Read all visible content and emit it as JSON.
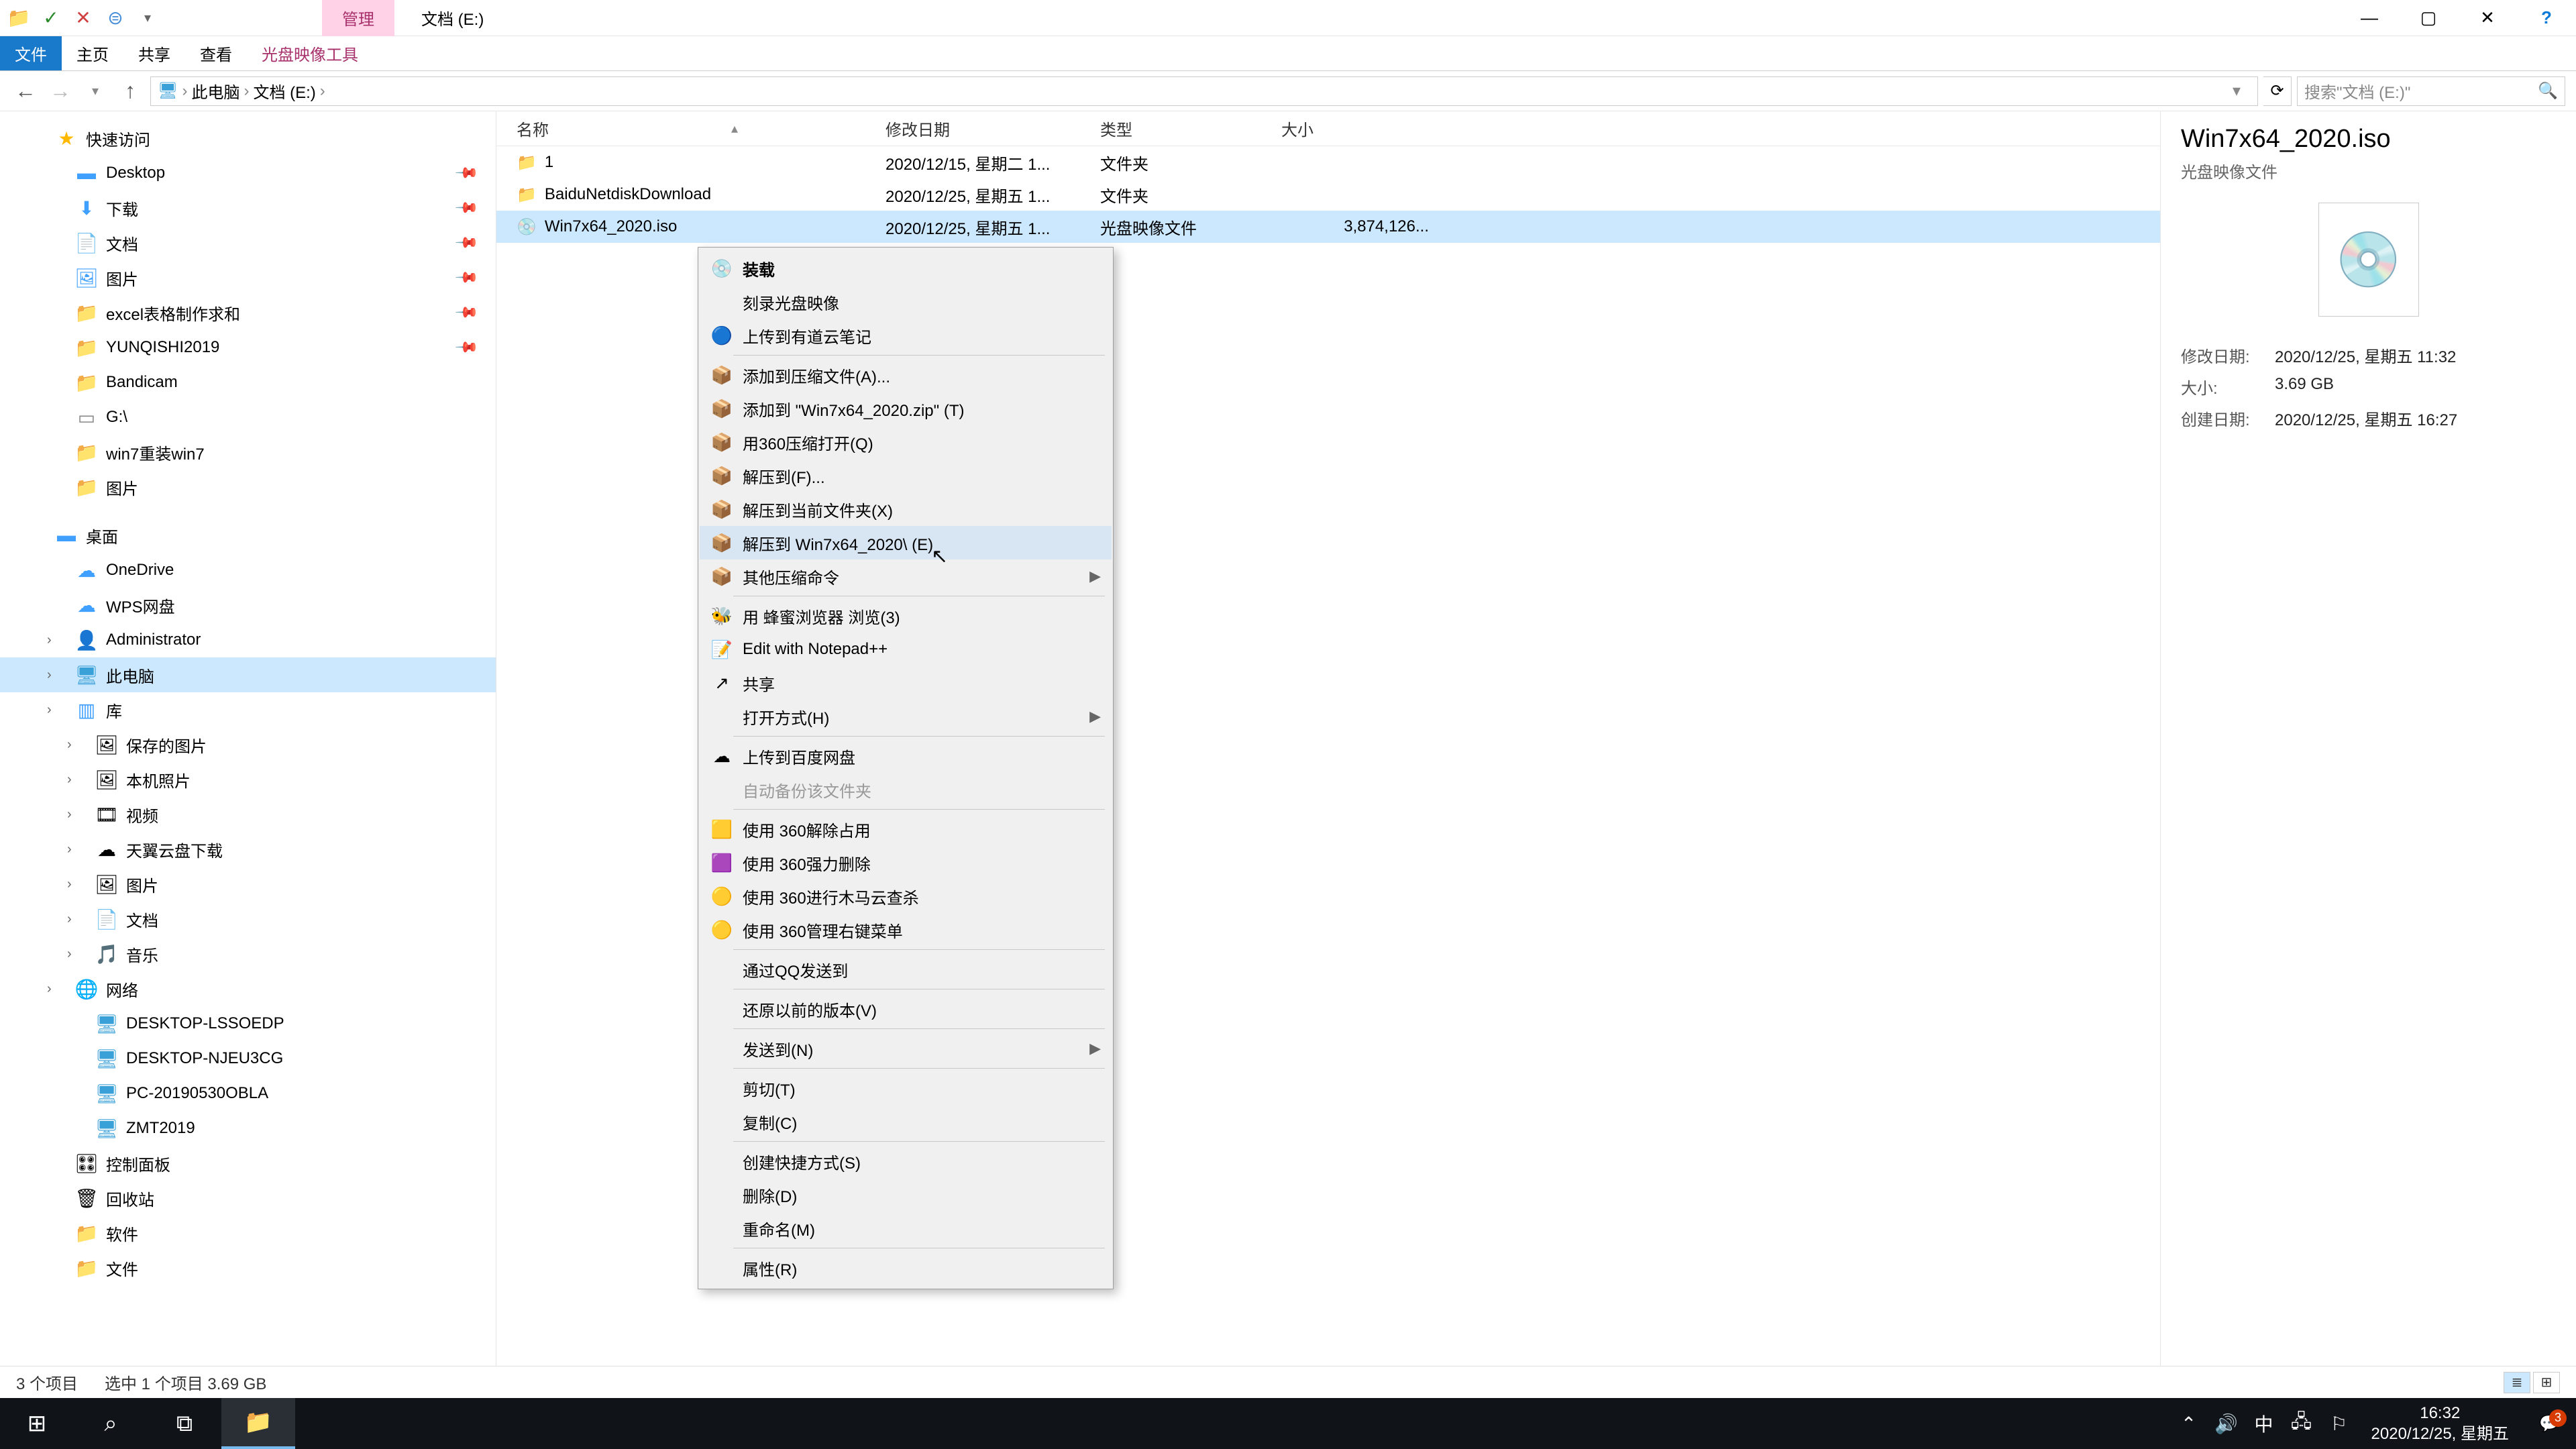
{
  "qat": {
    "folder": "📁",
    "check": "✓",
    "x": "✕",
    "eq": "⊜",
    "dd": "▾"
  },
  "title": {
    "manage": "管理",
    "text": "文档 (E:)"
  },
  "winctl": {
    "min": "—",
    "max": "▢",
    "close": "✕",
    "help": "?"
  },
  "ribbon": {
    "file": "文件",
    "home": "主页",
    "share": "共享",
    "view": "查看",
    "tool": "光盘映像工具"
  },
  "nav": {
    "back": "←",
    "fwd": "→",
    "up": "↑",
    "dd": "▾",
    "refresh": "⟳",
    "sep": "›"
  },
  "crumbs": [
    "此电脑",
    "文档 (E:)"
  ],
  "search": {
    "placeholder": "搜索\"文档 (E:)\"",
    "icon": "🔍"
  },
  "tree": [
    {
      "lvl": 0,
      "caret": "",
      "ico": "★",
      "cls": "star",
      "label": "快速访问"
    },
    {
      "lvl": 1,
      "caret": "",
      "ico": "▬",
      "cls": "blue-ico",
      "label": "Desktop",
      "pin": true
    },
    {
      "lvl": 1,
      "caret": "",
      "ico": "⬇",
      "cls": "blue-ico",
      "label": "下载",
      "pin": true
    },
    {
      "lvl": 1,
      "caret": "",
      "ico": "📄",
      "cls": "blue-ico",
      "label": "文档",
      "pin": true
    },
    {
      "lvl": 1,
      "caret": "",
      "ico": "🖼",
      "cls": "blue-ico",
      "label": "图片",
      "pin": true
    },
    {
      "lvl": 1,
      "caret": "",
      "ico": "📁",
      "cls": "folder-ico",
      "label": "excel表格制作求和",
      "pin": true
    },
    {
      "lvl": 1,
      "caret": "",
      "ico": "📁",
      "cls": "folder-ico",
      "label": "YUNQISHI2019",
      "pin": true
    },
    {
      "lvl": 1,
      "caret": "",
      "ico": "📁",
      "cls": "folder-ico",
      "label": "Bandicam"
    },
    {
      "lvl": 1,
      "caret": "",
      "ico": "▭",
      "cls": "drive-ico",
      "label": "G:\\"
    },
    {
      "lvl": 1,
      "caret": "",
      "ico": "📁",
      "cls": "folder-ico",
      "label": "win7重装win7"
    },
    {
      "lvl": 1,
      "caret": "",
      "ico": "📁",
      "cls": "folder-ico",
      "label": "图片"
    },
    {
      "lvl": 0,
      "caret": "",
      "ico": "▬",
      "cls": "blue-ico",
      "label": "桌面",
      "spacer": true
    },
    {
      "lvl": 1,
      "caret": "",
      "ico": "☁",
      "cls": "blue-ico",
      "label": "OneDrive"
    },
    {
      "lvl": 1,
      "caret": "",
      "ico": "☁",
      "cls": "blue-ico",
      "label": "WPS网盘"
    },
    {
      "lvl": 1,
      "caret": "›",
      "ico": "👤",
      "cls": "",
      "label": "Administrator"
    },
    {
      "lvl": 1,
      "caret": "›",
      "ico": "🖥",
      "cls": "mon-ico",
      "label": "此电脑",
      "sel": true
    },
    {
      "lvl": 1,
      "caret": "›",
      "ico": "▥",
      "cls": "blue-ico",
      "label": "库"
    },
    {
      "lvl": 2,
      "caret": "›",
      "ico": "🖼",
      "cls": "",
      "label": "保存的图片"
    },
    {
      "lvl": 2,
      "caret": "›",
      "ico": "🖼",
      "cls": "",
      "label": "本机照片"
    },
    {
      "lvl": 2,
      "caret": "›",
      "ico": "🎞",
      "cls": "",
      "label": "视频"
    },
    {
      "lvl": 2,
      "caret": "›",
      "ico": "☁",
      "cls": "",
      "label": "天翼云盘下载"
    },
    {
      "lvl": 2,
      "caret": "›",
      "ico": "🖼",
      "cls": "",
      "label": "图片"
    },
    {
      "lvl": 2,
      "caret": "›",
      "ico": "📄",
      "cls": "",
      "label": "文档"
    },
    {
      "lvl": 2,
      "caret": "›",
      "ico": "🎵",
      "cls": "",
      "label": "音乐"
    },
    {
      "lvl": 1,
      "caret": "›",
      "ico": "🌐",
      "cls": "",
      "label": "网络"
    },
    {
      "lvl": 2,
      "caret": "",
      "ico": "🖥",
      "cls": "mon-ico",
      "label": "DESKTOP-LSSOEDP"
    },
    {
      "lvl": 2,
      "caret": "",
      "ico": "🖥",
      "cls": "mon-ico",
      "label": "DESKTOP-NJEU3CG"
    },
    {
      "lvl": 2,
      "caret": "",
      "ico": "🖥",
      "cls": "mon-ico",
      "label": "PC-20190530OBLA"
    },
    {
      "lvl": 2,
      "caret": "",
      "ico": "🖥",
      "cls": "mon-ico",
      "label": "ZMT2019"
    },
    {
      "lvl": 1,
      "caret": "",
      "ico": "🎛",
      "cls": "",
      "label": "控制面板"
    },
    {
      "lvl": 1,
      "caret": "",
      "ico": "🗑",
      "cls": "",
      "label": "回收站"
    },
    {
      "lvl": 1,
      "caret": "",
      "ico": "📁",
      "cls": "folder-ico",
      "label": "软件"
    },
    {
      "lvl": 1,
      "caret": "",
      "ico": "📁",
      "cls": "folder-ico",
      "label": "文件"
    }
  ],
  "cols": {
    "name": "名称",
    "date": "修改日期",
    "type": "类型",
    "size": "大小",
    "sort": "▴"
  },
  "rows": [
    {
      "ico": "📁",
      "cls": "folder-ico",
      "name": "1",
      "date": "2020/12/15, 星期二 1...",
      "type": "文件夹",
      "size": ""
    },
    {
      "ico": "📁",
      "cls": "folder-ico",
      "name": "BaiduNetdiskDownload",
      "date": "2020/12/25, 星期五 1...",
      "type": "文件夹",
      "size": ""
    },
    {
      "ico": "💿",
      "cls": "disc-ico",
      "name": "Win7x64_2020.iso",
      "date": "2020/12/25, 星期五 1...",
      "type": "光盘映像文件",
      "size": "3,874,126...",
      "sel": true
    }
  ],
  "details": {
    "title": "Win7x64_2020.iso",
    "sub": "光盘映像文件",
    "icon": "💿",
    "mod_k": "修改日期:",
    "mod_v": "2020/12/25, 星期五 11:32",
    "size_k": "大小:",
    "size_v": "3.69 GB",
    "create_k": "创建日期:",
    "create_v": "2020/12/25, 星期五 16:27"
  },
  "ctx": [
    {
      "ico": "💿",
      "label": "装载",
      "bold": true
    },
    {
      "ico": "",
      "label": "刻录光盘映像"
    },
    {
      "ico": "🔵",
      "label": "上传到有道云笔记"
    },
    {
      "sep": true
    },
    {
      "ico": "📦",
      "label": "添加到压缩文件(A)..."
    },
    {
      "ico": "📦",
      "label": "添加到 \"Win7x64_2020.zip\" (T)"
    },
    {
      "ico": "📦",
      "label": "用360压缩打开(Q)"
    },
    {
      "ico": "📦",
      "label": "解压到(F)..."
    },
    {
      "ico": "📦",
      "label": "解压到当前文件夹(X)"
    },
    {
      "ico": "📦",
      "label": "解压到 Win7x64_2020\\ (E)",
      "hover": true
    },
    {
      "ico": "📦",
      "label": "其他压缩命令",
      "sub": true
    },
    {
      "sep": true
    },
    {
      "ico": "🐝",
      "label": "用 蜂蜜浏览器 浏览(3)"
    },
    {
      "ico": "📝",
      "label": "Edit with Notepad++"
    },
    {
      "ico": "↗",
      "label": "共享"
    },
    {
      "ico": "",
      "label": "打开方式(H)",
      "sub": true
    },
    {
      "sep": true
    },
    {
      "ico": "☁",
      "label": "上传到百度网盘"
    },
    {
      "ico": "",
      "label": "自动备份该文件夹",
      "disabled": true
    },
    {
      "sep": true
    },
    {
      "ico": "🟨",
      "label": "使用 360解除占用"
    },
    {
      "ico": "🟪",
      "label": "使用 360强力删除"
    },
    {
      "ico": "🟡",
      "label": "使用 360进行木马云查杀"
    },
    {
      "ico": "🟡",
      "label": "使用 360管理右键菜单"
    },
    {
      "sep": true
    },
    {
      "ico": "",
      "label": "通过QQ发送到"
    },
    {
      "sep": true
    },
    {
      "ico": "",
      "label": "还原以前的版本(V)"
    },
    {
      "sep": true
    },
    {
      "ico": "",
      "label": "发送到(N)",
      "sub": true
    },
    {
      "sep": true
    },
    {
      "ico": "",
      "label": "剪切(T)"
    },
    {
      "ico": "",
      "label": "复制(C)"
    },
    {
      "sep": true
    },
    {
      "ico": "",
      "label": "创建快捷方式(S)"
    },
    {
      "ico": "",
      "label": "删除(D)"
    },
    {
      "ico": "",
      "label": "重命名(M)"
    },
    {
      "sep": true
    },
    {
      "ico": "",
      "label": "属性(R)"
    }
  ],
  "status": {
    "count": "3 个项目",
    "sel": "选中 1 个项目  3.69 GB"
  },
  "taskbar": {
    "start": "⊞",
    "search": "⌕",
    "tasks": "⧉",
    "explorer": "📁",
    "tray_up": "⌃",
    "vol": "🔊",
    "ime": "中",
    "net": "🖧",
    "sec": "⚐",
    "time": "16:32",
    "date": "2020/12/25, 星期五",
    "notif": "💬",
    "badge": "3"
  }
}
